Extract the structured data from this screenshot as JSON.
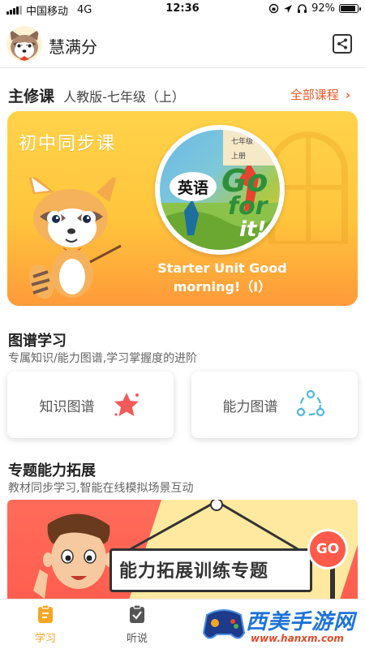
{
  "status_bar": {
    "carrier": "中国移动",
    "network": "4G",
    "time": "12:36",
    "battery": "92%",
    "battery_level": 0.92
  },
  "header": {
    "title": "慧满分"
  },
  "main_course": {
    "title": "主修课",
    "edition": "人教版-七年级（上）",
    "all_link": "全部课程",
    "card": {
      "tag": "初中同步课",
      "book_grade": "七年级",
      "book_volume": "上册",
      "book_subject": "英语",
      "book_title_1": "Go",
      "book_title_2": "for",
      "book_title_3": "it!",
      "unit_title": "Starter Unit Good morning!（Ⅰ）"
    }
  },
  "graph_learning": {
    "title": "图谱学习",
    "desc": "专属知识/能力图谱,学习掌握度的进阶",
    "knowledge_label": "知识图谱",
    "ability_label": "能力图谱"
  },
  "ability_extension": {
    "title": "专题能力拓展",
    "desc": "教材同步学习,智能在线模拟场景互动",
    "banner_text": "能力拓展训练专题",
    "go_sign": "GO"
  },
  "bottom_nav": {
    "items": [
      {
        "label": "学习",
        "active": true
      },
      {
        "label": "听说",
        "active": false
      }
    ]
  },
  "watermark": {
    "title": "西美手游网",
    "url": "www.hanxm.com"
  },
  "colors": {
    "accent": "#f05a28",
    "nav_active": "#f5a623",
    "nav_inactive": "#555555",
    "card_yellow": "#ffc53c",
    "banner_red": "#ff5e4f"
  }
}
